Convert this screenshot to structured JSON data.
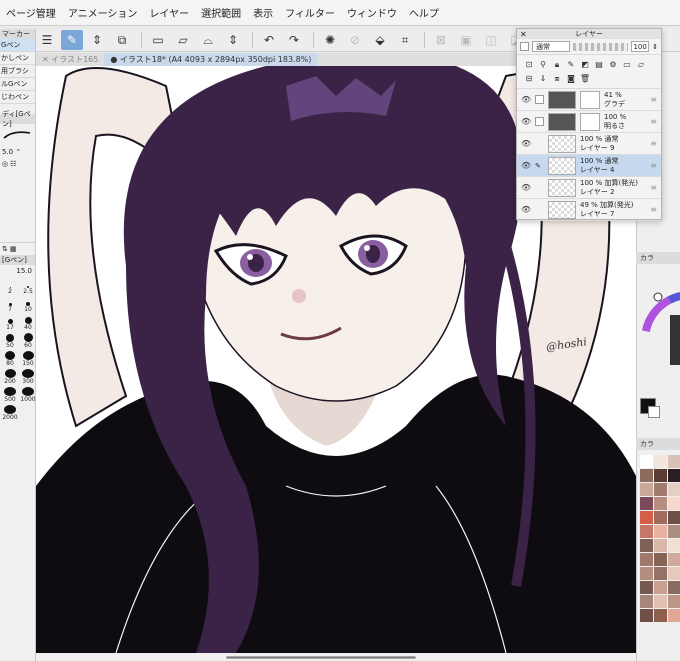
{
  "menu": [
    "ページ管理",
    "アニメーション",
    "レイヤー",
    "選択範囲",
    "表示",
    "フィルター",
    "ウィンドウ",
    "ヘルプ"
  ],
  "tabs": {
    "inactive": "イラスト165",
    "active": "イラスト18* (A4 4093 x 2894px 350dpi 183.8%)"
  },
  "left_panel": {
    "header": "マーカー",
    "brushes": [
      "Gペン",
      "かしペン",
      "用ブラシ",
      "ルGペン",
      "じわペン"
    ],
    "selected_brush": "ディ[Gペン]",
    "size_value": "5.0",
    "sub_header": "[Gペン]",
    "size_value2": "15.0",
    "dot_sizes": [
      "2",
      "2.5",
      "7",
      "10",
      "17",
      "40",
      "50",
      "60",
      "80",
      "150",
      "200",
      "300",
      "500",
      "1000",
      "2000"
    ]
  },
  "layer_panel": {
    "title": "レイヤー",
    "blend_mode": "通常",
    "opacity_value": "100",
    "layers": [
      {
        "percent": "41 %",
        "mode": "グラデ",
        "name": "",
        "selected": false
      },
      {
        "percent": "100 %",
        "mode": "明るさ",
        "name": "",
        "selected": false
      },
      {
        "percent": "100 % 通常",
        "mode": "",
        "name": "レイヤー 9",
        "selected": false
      },
      {
        "percent": "100 % 通常",
        "mode": "",
        "name": "レイヤー 4",
        "selected": true
      },
      {
        "percent": "100 % 加算(発光)",
        "mode": "",
        "name": "レイヤー 2",
        "selected": false
      },
      {
        "percent": "49 % 加算(発光)",
        "mode": "",
        "name": "レイヤー 7",
        "selected": false
      }
    ]
  },
  "right_panel": {
    "color_header": "カラ",
    "color_header2": "カラ"
  },
  "canvas": {
    "signature": "@hoshi"
  },
  "colors": {
    "hair": "#3a2347",
    "hair_light": "#6b4a86",
    "skin": "#f7efea",
    "shirt": "#111111",
    "accent": "#7aa6d8"
  },
  "swatches": [
    "#ffffff",
    "#f2e6dd",
    "#d8c2b5",
    "#8c6a5c",
    "#5a3b36",
    "#2b1d24",
    "#c9a89a",
    "#a07c6e",
    "#e3cfc4",
    "#7c4a58",
    "#b78e7e",
    "#f4d8cc",
    "#d35f4b",
    "#9e6b5d",
    "#6d5149",
    "#c47767",
    "#e8b2a2",
    "#ad8f82",
    "#7d6157",
    "#d6b7a8",
    "#f1dfd5",
    "#a0796c",
    "#856356",
    "#cfa99b",
    "#b48d7f",
    "#95716a",
    "#e7c9bb",
    "#765a52",
    "#c99f90",
    "#8a6b62",
    "#a58678",
    "#dfc0b1",
    "#bb9687",
    "#6f5048",
    "#8e5f4f",
    "#e0a794"
  ]
}
